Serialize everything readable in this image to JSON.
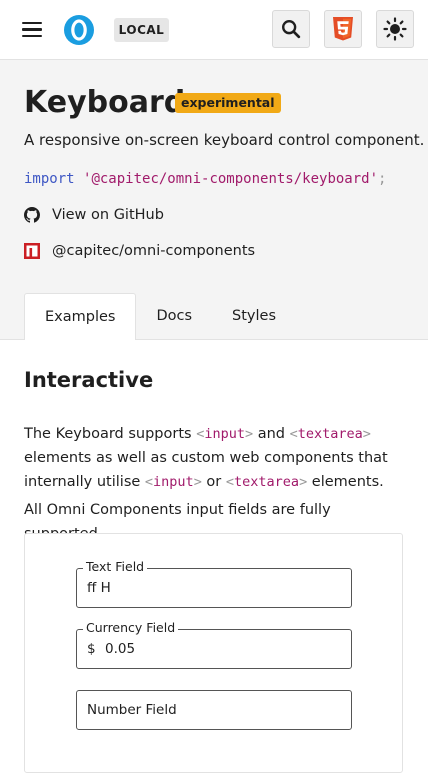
{
  "header": {
    "env_badge": "LOCAL",
    "icons": {
      "menu": "menu-icon",
      "logo": "omni-logo",
      "search": "search-icon",
      "html": "html5-icon",
      "theme": "sun-icon"
    },
    "colors": {
      "logo": "#1a9de0",
      "html5": "#e44d26"
    }
  },
  "component": {
    "title": "Keyboard",
    "status_badge": "experimental",
    "description": "A responsive on-screen keyboard control component.",
    "import": {
      "keyword": "import",
      "path": "'@capitec/omni-components/keyboard'",
      "semicolon": ";"
    },
    "links": {
      "github": "View on GitHub",
      "npm": "@capitec/omni-components"
    },
    "badge_color": "#f1a916"
  },
  "tabs": [
    {
      "label": "Examples",
      "active": true
    },
    {
      "label": "Docs",
      "active": false
    },
    {
      "label": "Styles",
      "active": false
    }
  ],
  "main": {
    "section_title": "Interactive",
    "para1": {
      "t1": "The Keyboard supports ",
      "tag_input": "input",
      "t2": " and ",
      "tag_textarea": "textarea",
      "t3": " elements as well as custom web components that internally utilise ",
      "tag_input2": "input",
      "t4": " or ",
      "tag_textarea2": "textarea",
      "t5": " elements."
    },
    "para2": "All Omni Components input fields are fully supported.",
    "fields": [
      {
        "label": "Text Field",
        "value": "ff H"
      },
      {
        "label": "Currency Field",
        "prefix": "$",
        "value": "0.05"
      },
      {
        "label": "Number Field",
        "value": ""
      }
    ]
  }
}
